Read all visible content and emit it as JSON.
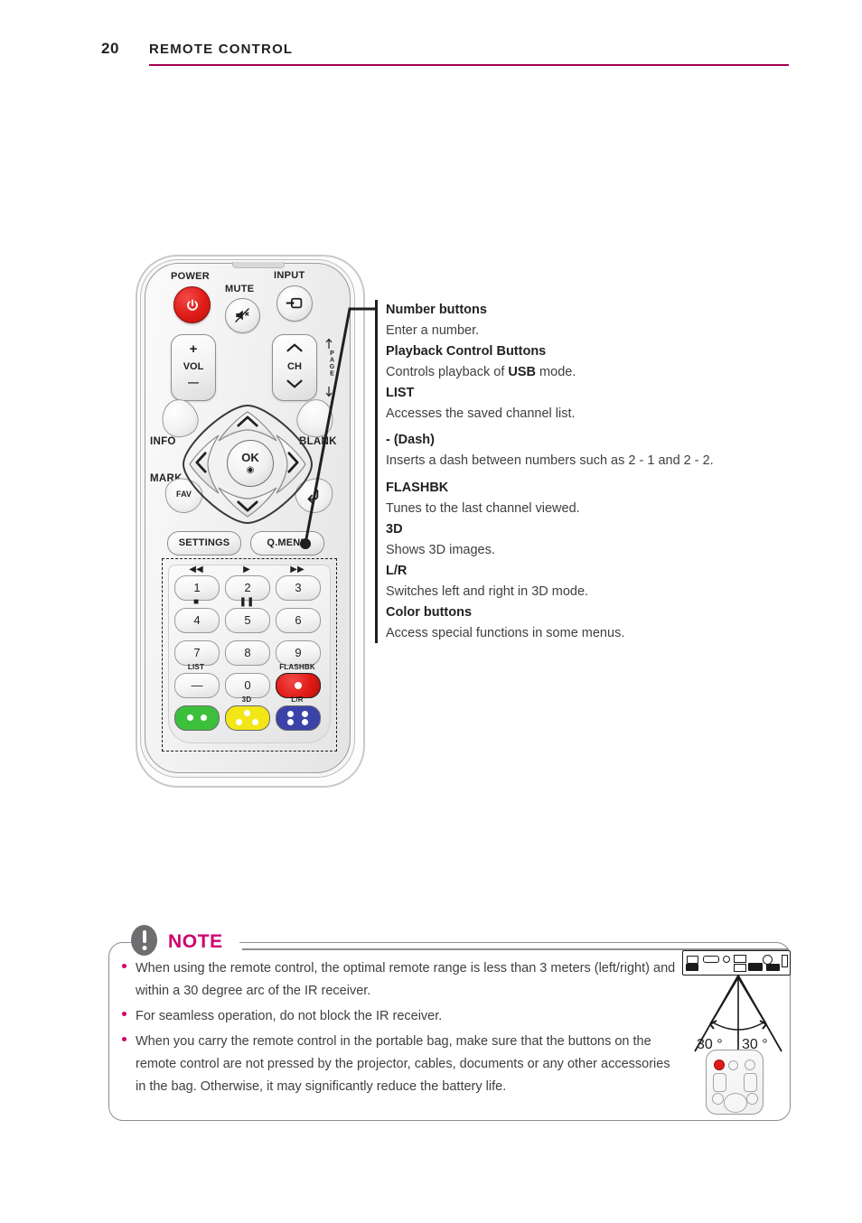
{
  "header": {
    "page_number": "20",
    "chapter": "REMOTE CONTROL",
    "rule_color": "#a5004f"
  },
  "remote": {
    "labels": {
      "power": "POWER",
      "mute": "MUTE",
      "input": "INPUT",
      "vol": "VOL",
      "vol_plus": "+",
      "vol_minus": "—",
      "ch": "CH",
      "ch_up": "⌃",
      "ch_down": "⌄",
      "page": "PAGE",
      "info": "INFO",
      "blank": "BLANK",
      "mark": "MARK",
      "fav": "FAV",
      "ok": "OK",
      "ok_sub": "◉",
      "settings": "SETTINGS",
      "q_menu": "Q.MENU"
    },
    "icons": {
      "power": "power-icon",
      "mute": "mute-icon",
      "input": "input-source-icon",
      "back": "back-arrow-icon",
      "nav_up": "chevron-up-icon",
      "nav_down": "chevron-down-icon",
      "nav_left": "chevron-left-icon",
      "nav_right": "chevron-right-icon"
    },
    "keypad": {
      "keys": [
        {
          "label": "1",
          "top_icon": "◀◀",
          "top_label": "",
          "icon_name": "rewind-icon"
        },
        {
          "label": "2",
          "top_icon": "▶",
          "top_label": "",
          "icon_name": "play-icon"
        },
        {
          "label": "3",
          "top_icon": "▶▶",
          "top_label": "",
          "icon_name": "fast-forward-icon"
        },
        {
          "label": "4",
          "top_icon": "■",
          "top_label": "",
          "icon_name": "stop-icon"
        },
        {
          "label": "5",
          "top_icon": "❚❚",
          "top_label": "",
          "icon_name": "pause-icon"
        },
        {
          "label": "6",
          "top_icon": "",
          "top_label": "",
          "icon_name": ""
        },
        {
          "label": "7",
          "top_icon": "",
          "top_label": "",
          "icon_name": ""
        },
        {
          "label": "8",
          "top_icon": "",
          "top_label": "",
          "icon_name": ""
        },
        {
          "label": "9",
          "top_icon": "",
          "top_label": "",
          "icon_name": ""
        },
        {
          "label": "—",
          "top_icon": "",
          "top_label": "LIST",
          "icon_name": "dash-icon"
        },
        {
          "label": "0",
          "top_icon": "",
          "top_label": "",
          "icon_name": ""
        },
        {
          "label": "",
          "top_icon": "",
          "top_label": "FLASHBK",
          "icon_name": "flashbk-icon"
        }
      ],
      "color_buttons": [
        {
          "name": "green-button",
          "top_label": "",
          "color": "#3cc03c",
          "dots": 2
        },
        {
          "name": "yellow-button",
          "top_label": "3D",
          "color": "#f2e616",
          "dots": 3
        },
        {
          "name": "blue-button",
          "top_label": "L/R",
          "color": "#3c43a8",
          "dots": 4
        }
      ],
      "flashbk_color": "#e31b16"
    }
  },
  "description": {
    "entries": [
      {
        "heading": "Number buttons",
        "body": "Enter a number.",
        "body_bold": ""
      },
      {
        "heading": "Playback Control Buttons",
        "body_pre": "Controls playback of ",
        "body_bold": "USB",
        "body_post": " mode."
      },
      {
        "heading": "LIST",
        "body": "Accesses the saved channel list."
      },
      {
        "heading": "- (Dash)",
        "body": "Inserts a dash between numbers such as 2 - 1 and 2 - 2."
      },
      {
        "heading": "FLASHBK",
        "body": "Tunes to the last channel viewed."
      },
      {
        "heading": "3D",
        "body": "Shows 3D images."
      },
      {
        "heading": "L/R",
        "body": "Switches left and right in 3D mode."
      },
      {
        "heading": "Color buttons",
        "body": "Access special functions in some menus."
      }
    ]
  },
  "note": {
    "title": "NOTE",
    "title_color": "#d0006f",
    "icon": "exclamation-circle-icon",
    "items": [
      "When using the remote control, the optimal remote range is less than 3 meters (left/right) and within a 30 degree arc of the IR receiver.",
      "For seamless operation, do not block the IR receiver.",
      "When you carry the remote control in the portable bag, make sure that the buttons on the remote control are not pressed by the projector, cables, documents or any other accessories in the bag. Otherwise, it may significantly reduce the battery life."
    ],
    "diagram": {
      "angle_left": "30 °",
      "angle_right": "30 °",
      "panel_name": "projector-rear-panel",
      "remote_name": "mini-remote"
    }
  }
}
